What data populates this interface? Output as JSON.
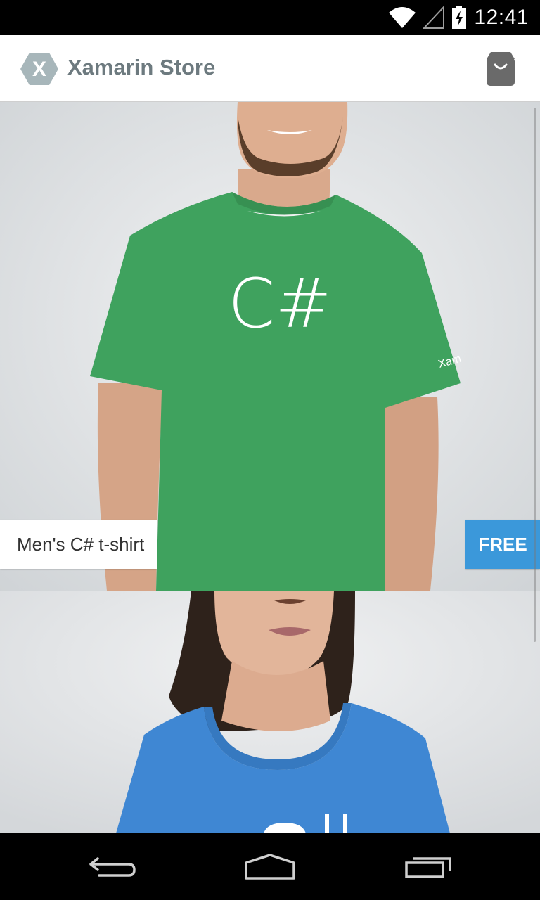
{
  "status_bar": {
    "time": "12:41"
  },
  "app": {
    "title": "Xamarin Store",
    "logo_letter": "X"
  },
  "products": [
    {
      "name": "Men's C# t-shirt",
      "price": "FREE",
      "shirt_text": "C#",
      "shirt_color": "#3fa25e",
      "sleeve_text": "Xam"
    },
    {
      "shirt_color": "#3f87d3"
    }
  ],
  "colors": {
    "price_badge": "#3b98da",
    "title": "#6d7a7f"
  },
  "icons": [
    "wifi-icon",
    "signal-icon",
    "battery-icon",
    "shopping-bag-icon",
    "back-icon",
    "home-icon",
    "recent-apps-icon"
  ]
}
